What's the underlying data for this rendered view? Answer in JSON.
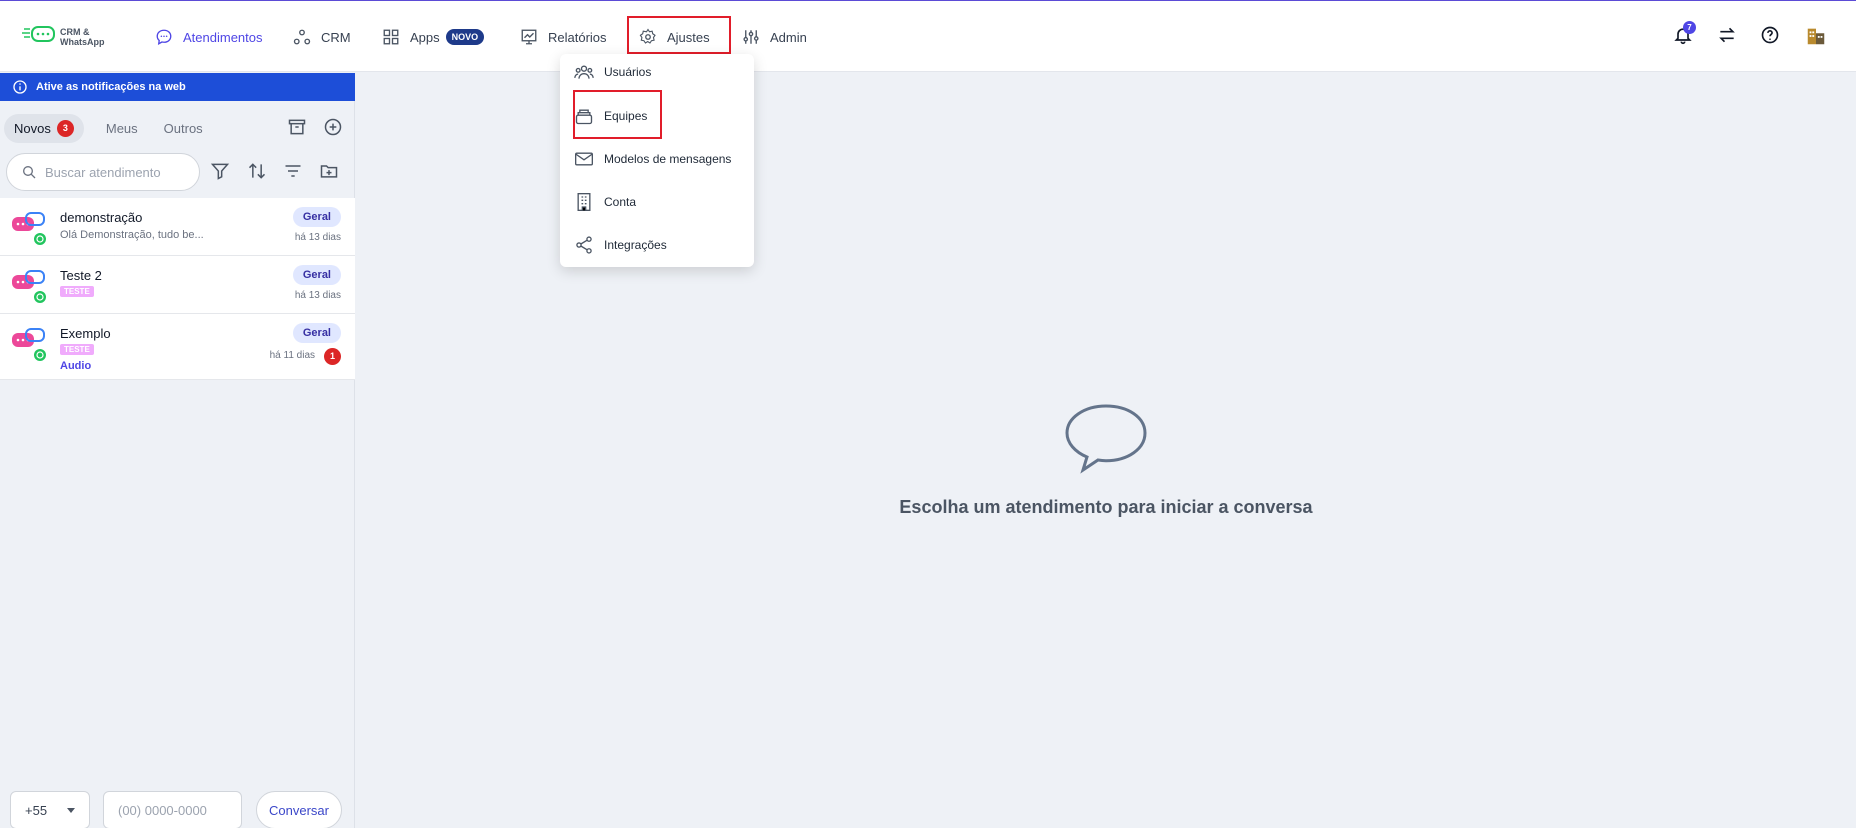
{
  "logo": {
    "text_line1": "CRM &",
    "text_line2": "WhatsApp"
  },
  "nav": {
    "atendimentos": "Atendimentos",
    "crm": "CRM",
    "apps": "Apps",
    "apps_badge": "NOVO",
    "relatorios": "Relatórios",
    "ajustes": "Ajustes",
    "admin": "Admin"
  },
  "header_icons": {
    "notifications_count": "7"
  },
  "banner": {
    "text": "Ative as notificações na web"
  },
  "tabs": [
    {
      "label": "Novos",
      "count": "3"
    },
    {
      "label": "Meus"
    },
    {
      "label": "Outros"
    }
  ],
  "search": {
    "placeholder": "Buscar atendimento"
  },
  "conversations": [
    {
      "name": "demonstração",
      "preview": "Olá Demonstração, tudo be...",
      "team": "Geral",
      "time": "há 13 dias"
    },
    {
      "name": "Teste 2",
      "tag": "TESTE",
      "team": "Geral",
      "time": "há 13 dias"
    },
    {
      "name": "Exemplo",
      "tag": "TESTE",
      "sub": "Audio",
      "team": "Geral",
      "time": "há 11 dias",
      "unread": "1"
    }
  ],
  "composer": {
    "country_code": "+55",
    "phone_placeholder": "(00) 0000-0000",
    "button": "Conversar"
  },
  "empty_state": {
    "text": "Escolha um atendimento para iniciar a conversa"
  },
  "ajustes_menu": {
    "items": [
      "Usuários",
      "Equipes",
      "Modelos de mensagens",
      "Conta",
      "Integrações"
    ]
  },
  "colors": {
    "accent": "#4f46e5",
    "banner": "#1d4ed8",
    "highlight": "#e11d2a",
    "badge": "#dc2626"
  }
}
